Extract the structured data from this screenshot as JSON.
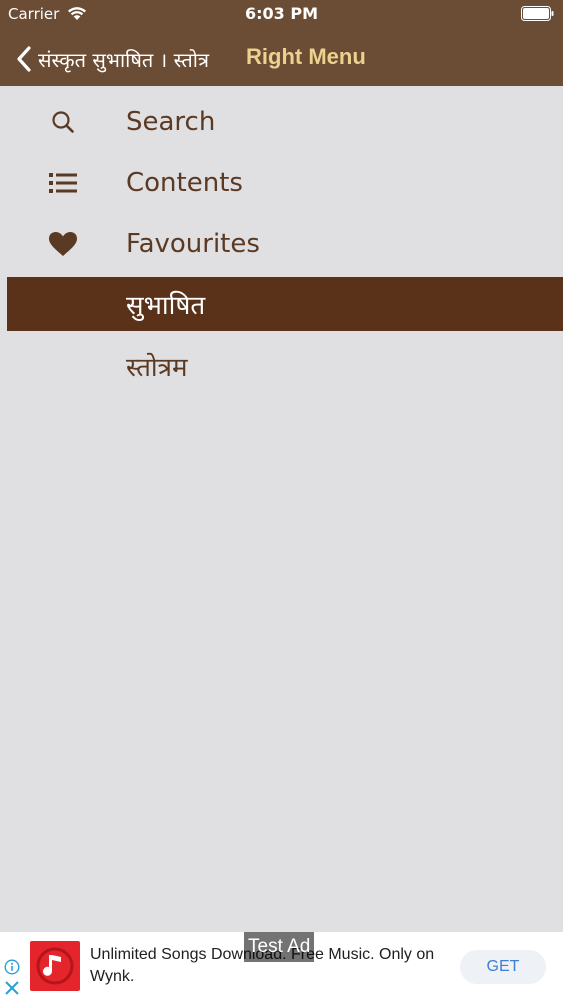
{
  "status_bar": {
    "carrier": "Carrier",
    "time": "6:03 PM"
  },
  "nav_bar": {
    "back_label": "संस्कृत सुभाषित । स्तोत्र",
    "title": "Right Menu"
  },
  "menu": {
    "items": [
      {
        "label": "Search",
        "icon": "search-icon"
      },
      {
        "label": "Contents",
        "icon": "list-icon"
      },
      {
        "label": "Favourites",
        "icon": "heart-icon"
      },
      {
        "label": "सुभाषित",
        "icon": "",
        "selected": true
      },
      {
        "label": "स्तोत्रम",
        "icon": ""
      }
    ]
  },
  "ad": {
    "text": "Unlimited Songs Download. Free Music. Only on Wynk.",
    "test_label": "Test Ad",
    "cta": "GET",
    "app_icon": "music-note-icon"
  },
  "colors": {
    "header_bg": "#6b4c34",
    "title_accent": "#ecd18f",
    "menu_bg": "#e0dfe1",
    "menu_text": "#5b3a24",
    "selected_bg": "#593219",
    "ad_cta": "#3f7fd0"
  }
}
